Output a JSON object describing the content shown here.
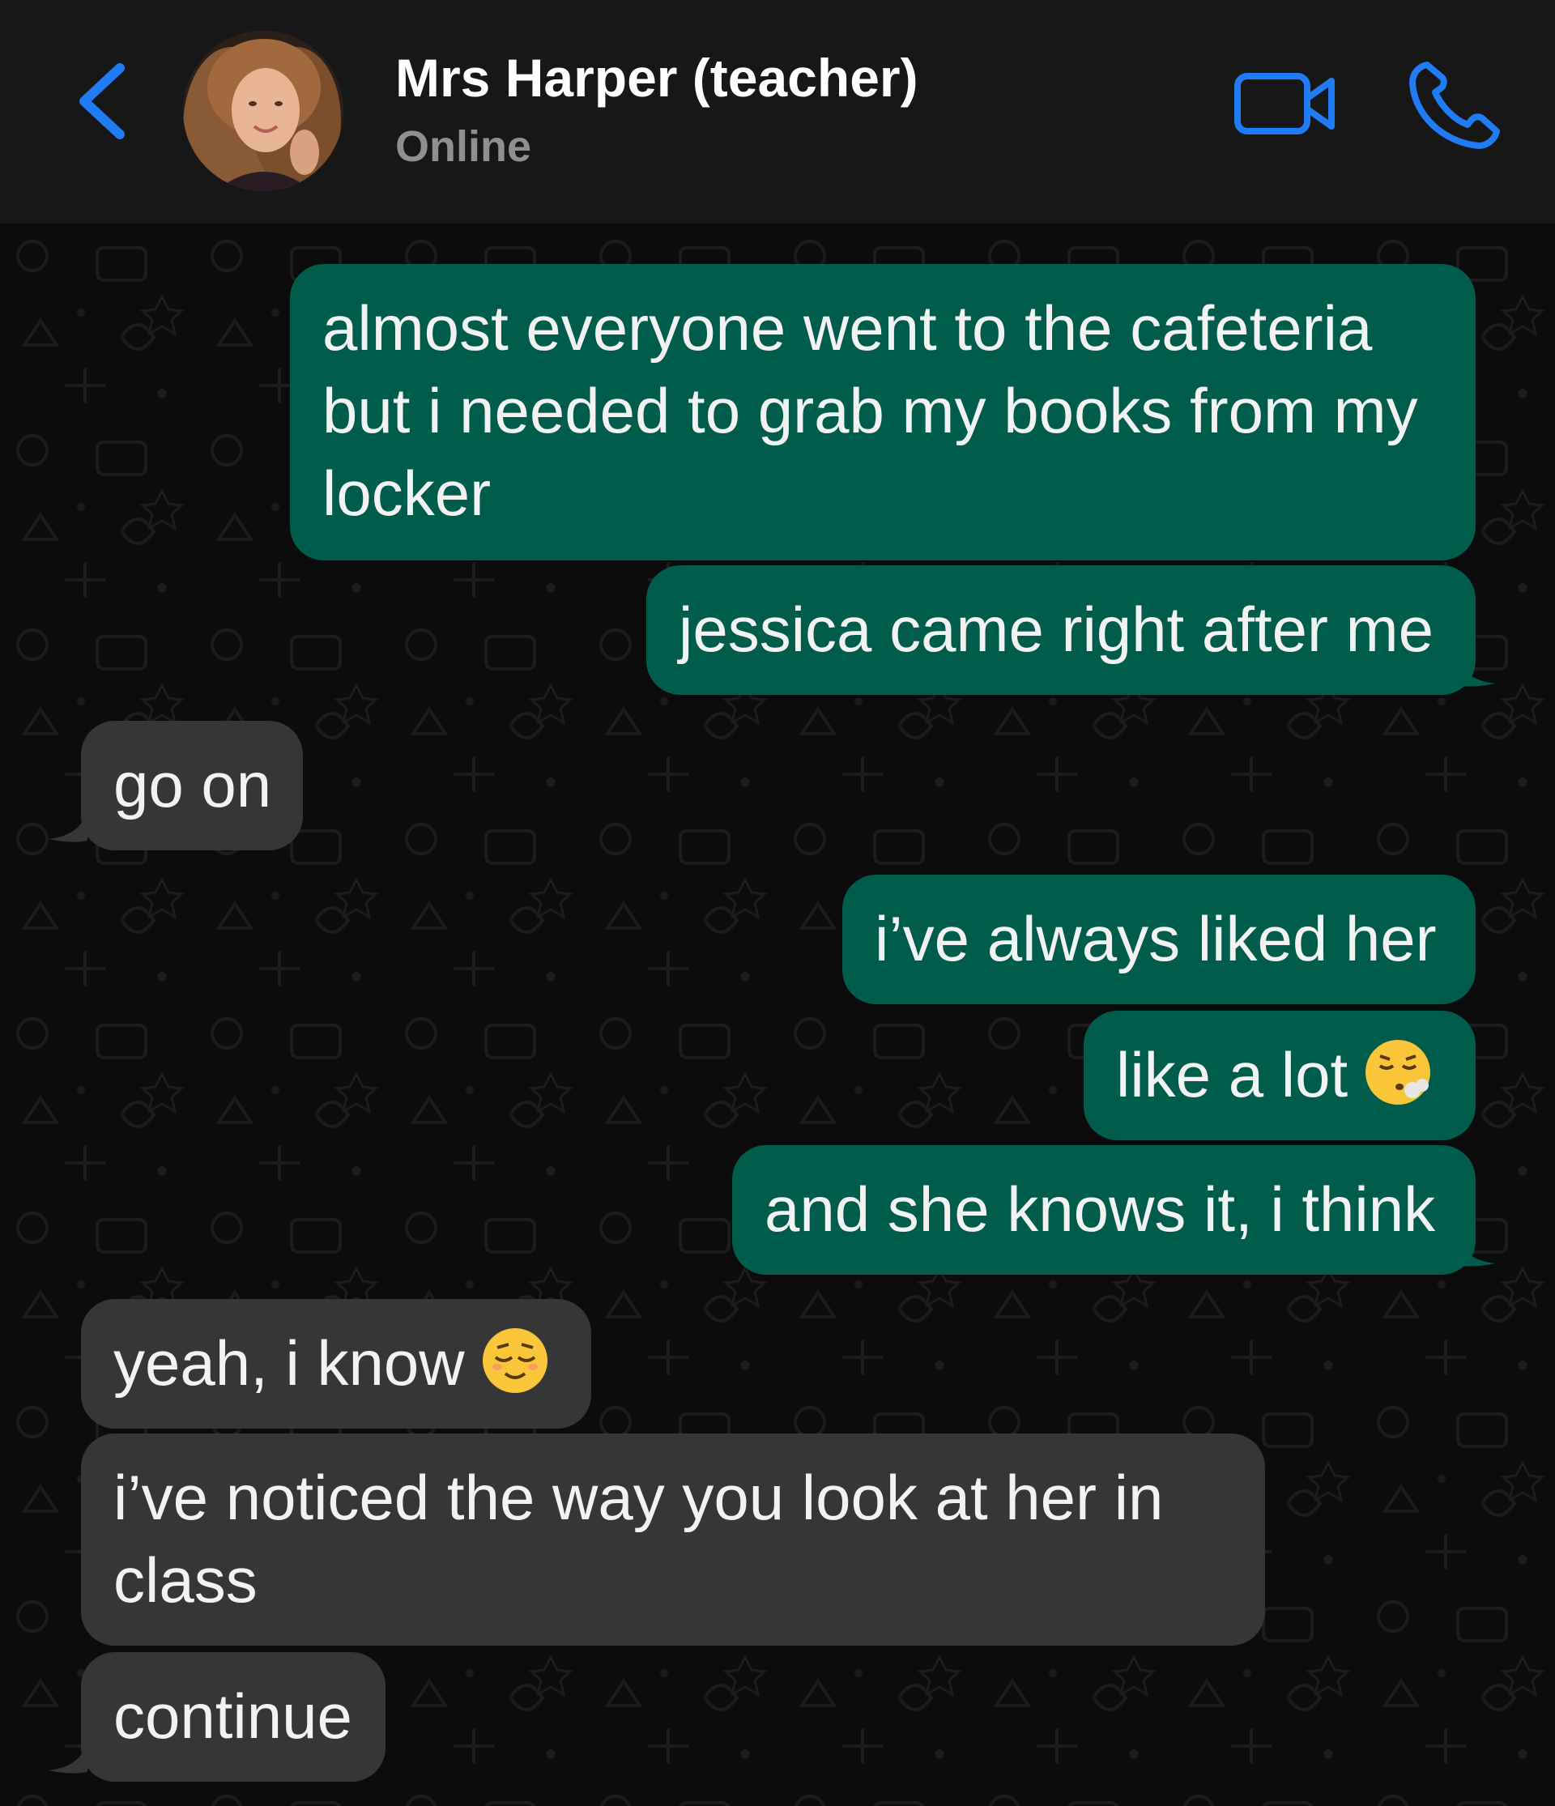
{
  "header": {
    "contact_name": "Mrs Harper (teacher)",
    "status": "Online",
    "back_icon": "chevron-left-icon",
    "video_icon": "video-camera-icon",
    "call_icon": "phone-icon",
    "accent_color": "#1f7cf4"
  },
  "colors": {
    "header_bg": "#171717",
    "chat_bg": "#0c0c0c",
    "outgoing_bubble": "#005c4b",
    "incoming_bubble": "#363636",
    "text": "#f2f2f2"
  },
  "messages": [
    {
      "direction": "outgoing",
      "lines": [
        "almost everyone went to the cafeteria",
        "but i needed to grab my books from my",
        "locker"
      ]
    },
    {
      "direction": "outgoing",
      "lines": [
        "jessica came right after me"
      ]
    },
    {
      "direction": "incoming",
      "lines": [
        "go on"
      ]
    },
    {
      "direction": "outgoing",
      "lines": [
        "i’ve always liked her"
      ]
    },
    {
      "direction": "outgoing",
      "lines": [
        "like a lot"
      ],
      "emoji": "face-exhaling-emoji"
    },
    {
      "direction": "outgoing",
      "lines": [
        "and she knows it, i think"
      ]
    },
    {
      "direction": "incoming",
      "lines": [
        "yeah, i know"
      ],
      "emoji": "relieved-face-emoji"
    },
    {
      "direction": "incoming",
      "lines": [
        "i’ve noticed the way you look at her in",
        "class"
      ]
    },
    {
      "direction": "incoming",
      "lines": [
        "continue"
      ]
    }
  ]
}
